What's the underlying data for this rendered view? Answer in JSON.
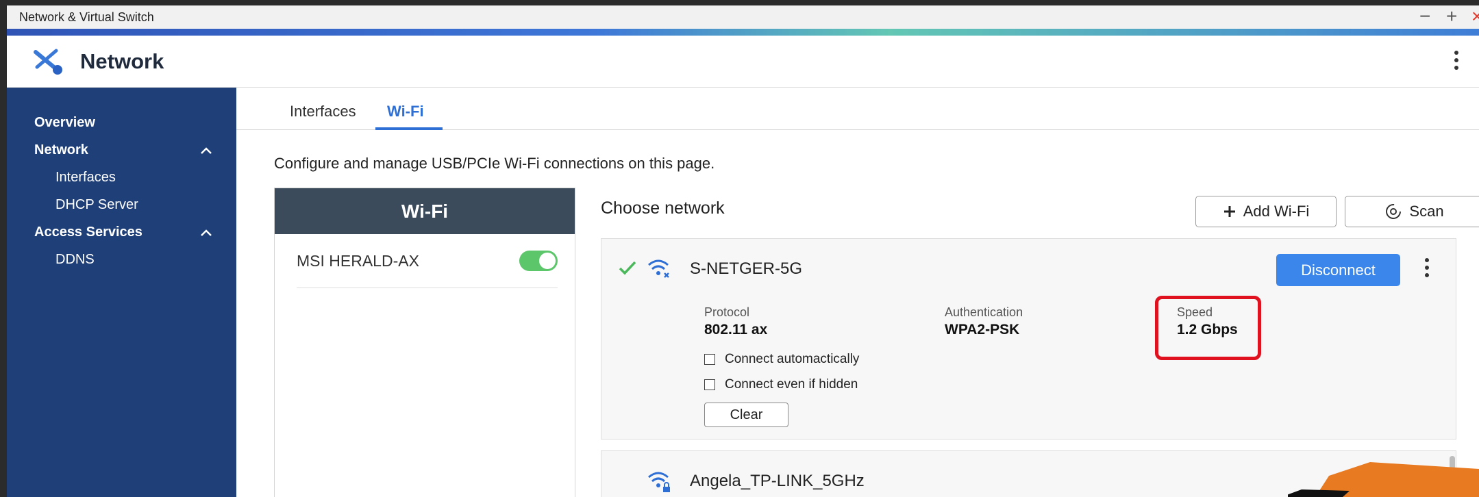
{
  "window": {
    "title": "Network & Virtual Switch"
  },
  "app": {
    "title": "Network"
  },
  "sidebar": {
    "items": [
      {
        "label": "Overview"
      },
      {
        "label": "Network"
      },
      {
        "label": "Interfaces"
      },
      {
        "label": "DHCP Server"
      },
      {
        "label": "Access Services"
      },
      {
        "label": "DDNS"
      }
    ]
  },
  "tabs": [
    {
      "label": "Interfaces",
      "active": false
    },
    {
      "label": "Wi-Fi",
      "active": true
    }
  ],
  "description": "Configure and manage USB/PCIe Wi-Fi connections on this page.",
  "wifi_panel": {
    "title": "Wi-Fi",
    "adapter": "MSI HERALD-AX",
    "adapter_enabled": true
  },
  "choose_network": {
    "heading": "Choose network",
    "add_label": "Add Wi-Fi",
    "scan_label": "Scan"
  },
  "networks": [
    {
      "name": "S-NETGER-5G",
      "connected": true,
      "action_label": "Disconnect",
      "protocol_label": "Protocol",
      "protocol_value": "802.11 ax",
      "auth_label": "Authentication",
      "auth_value": "WPA2-PSK",
      "speed_label": "Speed",
      "speed_value": "1.2 Gbps",
      "connect_auto_label": "Connect automactically",
      "connect_hidden_label": "Connect even if hidden",
      "clear_label": "Clear"
    },
    {
      "name": "Angela_TP-LINK_5GHz"
    }
  ],
  "colors": {
    "sidebar_bg": "#1f3f78",
    "accent": "#2e6fd6",
    "disconnect_bg": "#3b86ea",
    "toggle_on": "#5cc66a",
    "highlight": "#e0121f"
  }
}
